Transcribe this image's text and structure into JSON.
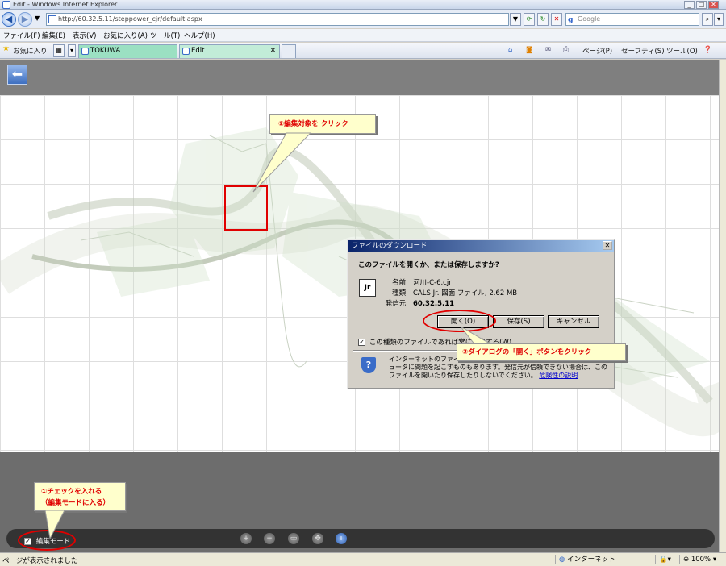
{
  "browser": {
    "window_title": "Edit - Windows Internet Explorer",
    "url": "http://60.32.5.11/steppower_cjr/default.aspx",
    "search_placeholder": "Google",
    "menu": [
      "ファイル(F)",
      "編集(E)",
      "表示(V)",
      "お気に入り(A)",
      "ツール(T)",
      "ヘルプ(H)"
    ],
    "favorites_label": "お気に入り",
    "tabs": [
      {
        "label": "TOKUWA"
      },
      {
        "label": "Edit"
      }
    ],
    "command_bar": {
      "page": "ページ(P)",
      "safety": "セーフティ(S)",
      "tools": "ツール(O)"
    }
  },
  "app": {
    "edit_mode_label": "編集モード",
    "edit_mode_checked": true
  },
  "callouts": {
    "step1_line1": "①チェックを入れる",
    "step1_line2": "（編集モードに入る）",
    "step2": "②編集対象を クリック",
    "step3": "③ダイアログの「開く」ボタンをクリック"
  },
  "dialog": {
    "title": "ファイルのダウンロード",
    "question": "このファイルを開くか、または保存しますか?",
    "name_label": "名前:",
    "name_value": "河川-C-6.cjr",
    "type_label": "種類:",
    "type_value": "CALS Jr. 図面 ファイル, 2.62 MB",
    "from_label": "発信元:",
    "from_value": "60.32.5.11",
    "open_button": "開く(O)",
    "save_button": "保存(S)",
    "cancel_button": "キャンセル",
    "always_ask_label": "この種類のファイルであれば常に警告する(W)",
    "always_ask_checked": true,
    "warning_text": "インターネットのファイルは役に立ちますが、このファイルの種類はコンピュータに問題を起こすものもあります。発信元が信頼できない場合は、このファイルを開いたり保存したりしないでください。",
    "risk_link": "危険性の説明",
    "file_icon_text": "Jr"
  },
  "statusbar": {
    "text": "ページが表示されました",
    "zone": "インターネット",
    "zoom": "100%"
  }
}
